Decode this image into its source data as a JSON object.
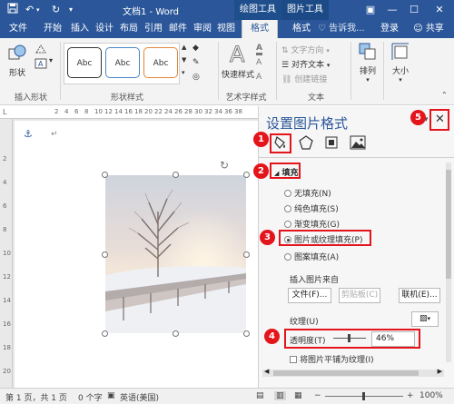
{
  "titlebar": {
    "title": "文档1 - Word",
    "context_groups": [
      "绘图工具",
      "图片工具"
    ],
    "undo_icon": "undo-icon",
    "redo_icon": "redo-icon"
  },
  "tabs": [
    "文件",
    "开始",
    "插入",
    "设计",
    "布局",
    "引用",
    "邮件",
    "审阅",
    "视图",
    "格式",
    "格式"
  ],
  "tell_me": "告诉我...",
  "login": "登录",
  "share": "共享",
  "ribbon": {
    "insert_shape": {
      "label": "形状",
      "group": "插入形状"
    },
    "style_boxes": [
      "Abc",
      "Abc",
      "Abc"
    ],
    "style_group": "形状样式",
    "quick_styles": "快速样式",
    "art_group": "艺术字样式",
    "text_items": [
      "文字方向",
      "对齐文本",
      "创建链接"
    ],
    "text_group": "文本",
    "arrange": "排列",
    "size": "大小"
  },
  "ruler": {
    "h_ticks": [
      "2",
      "4",
      "6",
      "8",
      "10",
      "12",
      "14",
      "16",
      "18",
      "20",
      "22",
      "24",
      "26",
      "28",
      "30",
      "32",
      "34",
      "36",
      "38"
    ],
    "v_ticks": [
      "2",
      "4",
      "6",
      "8",
      "10",
      "12",
      "14",
      "16",
      "18",
      "20"
    ]
  },
  "pane": {
    "title": "设置图片格式",
    "fill_header": "填充",
    "fill_options": [
      "无填充(N)",
      "纯色填充(S)",
      "渐变填充(G)",
      "图片或纹理填充(P)",
      "图案填充(A)"
    ],
    "selected_option": 3,
    "insert_from": "插入图片来自",
    "buttons": [
      "文件(F)...",
      "剪贴板(C)",
      "联机(E)..."
    ],
    "texture": "纹理(U)",
    "transparency_label": "透明度(T)",
    "transparency_value": "46%",
    "transparency": 0.46,
    "tile_label": "将图片平铺为纹理(I)"
  },
  "badges": [
    "1",
    "2",
    "3",
    "4",
    "5"
  ],
  "statusbar": {
    "page": "第 1 页，共 1 页",
    "words": "0 个字",
    "language": "英语(美国)",
    "zoom": "100%"
  },
  "colors": {
    "accent": "#2b579a",
    "annotation_red": "#e4141b"
  }
}
